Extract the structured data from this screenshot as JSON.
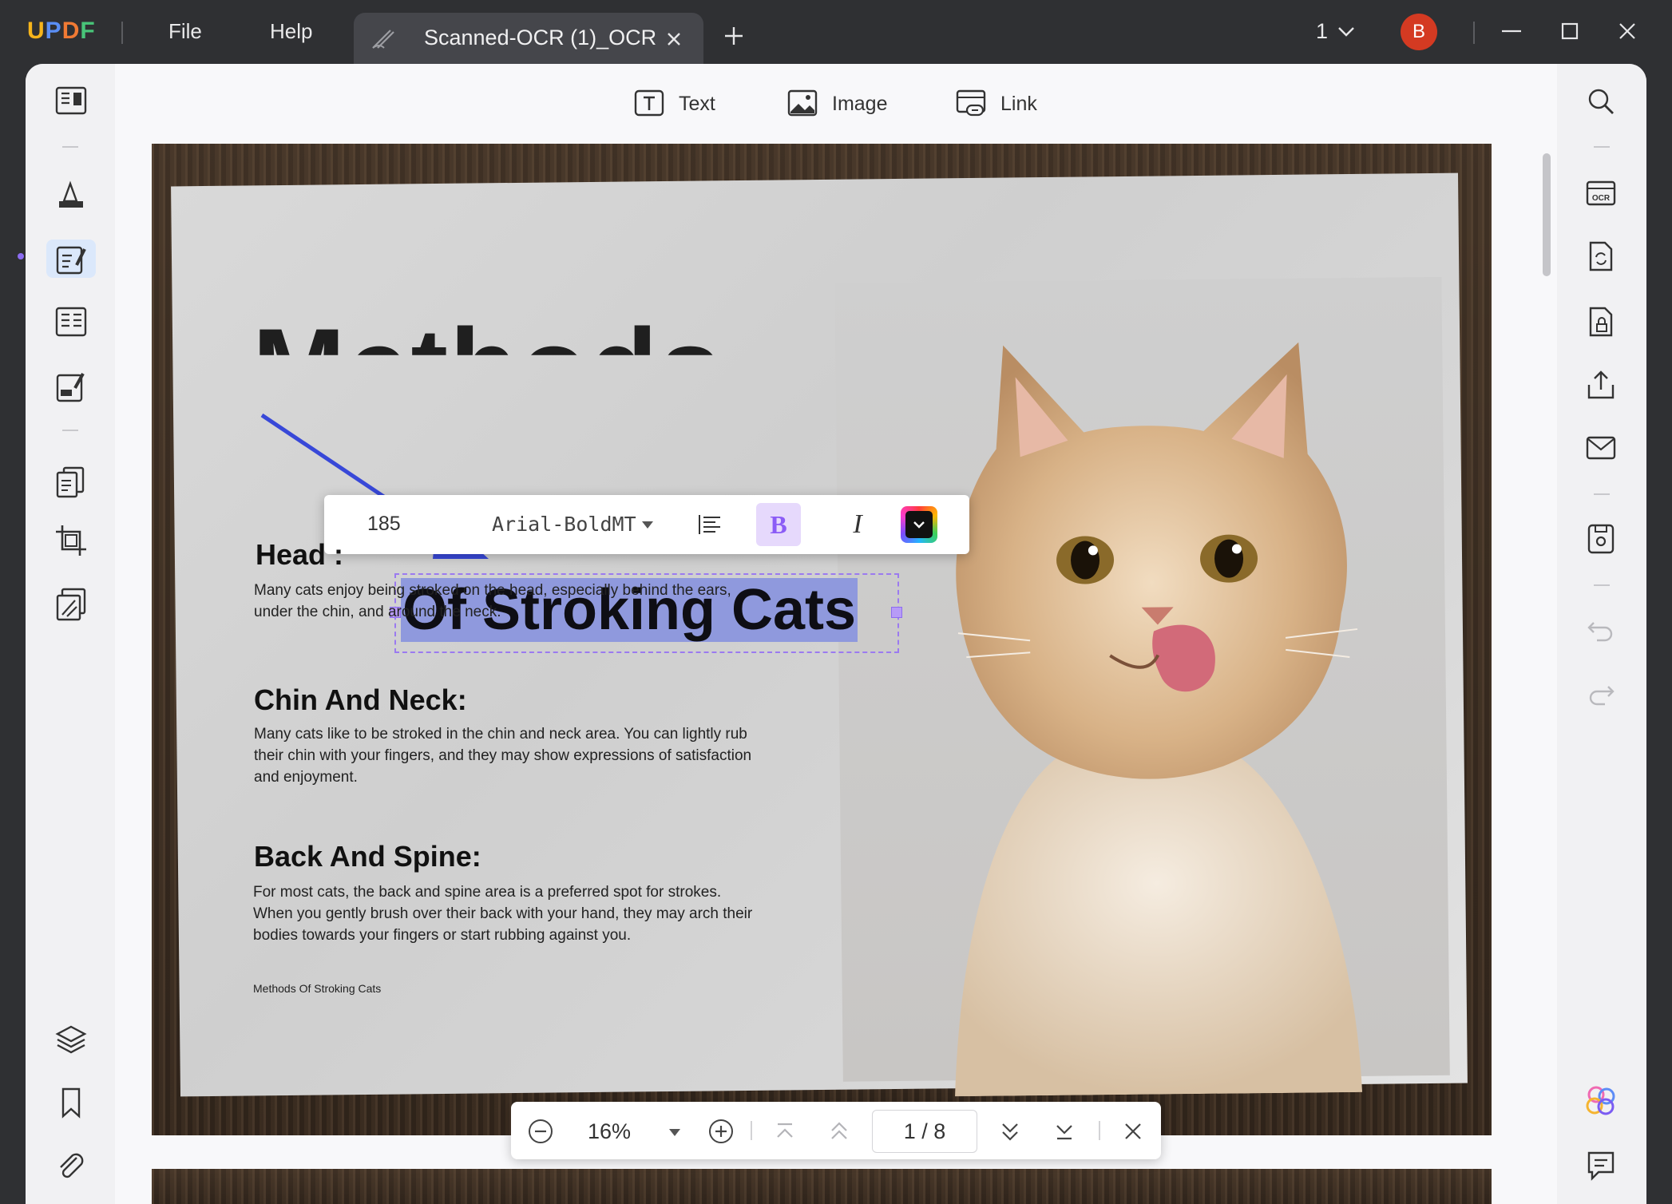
{
  "app": {
    "logo": [
      "U",
      "P",
      "D",
      "F"
    ],
    "menu": {
      "file": "File",
      "help": "Help"
    },
    "tab": {
      "title": "Scanned-OCR (1)_OCR"
    },
    "page_selector": "1",
    "avatar_initial": "B"
  },
  "toolbar": {
    "text_label": "Text",
    "image_label": "Image",
    "link_label": "Link"
  },
  "format_bar": {
    "font_size": "185",
    "font_name": "Arial-BoldMT",
    "bold": "B",
    "italic": "I"
  },
  "document": {
    "ghost_title": "Methods",
    "selected_title": "Of Stroking Cats",
    "sections": [
      {
        "heading": "Head :",
        "body": "Many cats enjoy being stroked on the head, especially behind the ears, under the chin, and around the neck."
      },
      {
        "heading": "Chin And Neck:",
        "body": "Many cats like to be stroked in the chin and neck area. You can lightly rub their chin with your fingers, and they may show expressions of satisfaction and enjoyment."
      },
      {
        "heading": "Back And Spine:",
        "body": "For most cats, the back and spine area is a preferred spot for strokes. When you gently brush over their back with your hand, they may arch their bodies towards your fingers or start rubbing against you."
      }
    ],
    "footer": "Methods Of Stroking Cats"
  },
  "bottom_nav": {
    "zoom": "16%",
    "current_page": "1",
    "separator": "/",
    "total_pages": "8"
  },
  "colors": {
    "accent_purple": "#8b5cf6",
    "selection_fill": "#8f99dd",
    "avatar": "#d43a22",
    "active_tool_bg": "#dbe8fb",
    "titlebar": "#2f3033"
  },
  "icons": {
    "left_sidebar": [
      "reader-icon",
      "comment-icon",
      "edit-pdf-icon",
      "organize-icon",
      "fill-sign-icon",
      "pages-icon",
      "crop-icon",
      "protect-icon",
      "layers-icon",
      "bookmark-icon",
      "attachment-icon"
    ],
    "right_sidebar": [
      "search-icon",
      "ocr-icon",
      "convert-icon",
      "protect-file-icon",
      "share-icon",
      "email-icon",
      "save-icon",
      "undo-icon",
      "redo-icon",
      "ai-assistant-icon",
      "comments-icon"
    ]
  }
}
